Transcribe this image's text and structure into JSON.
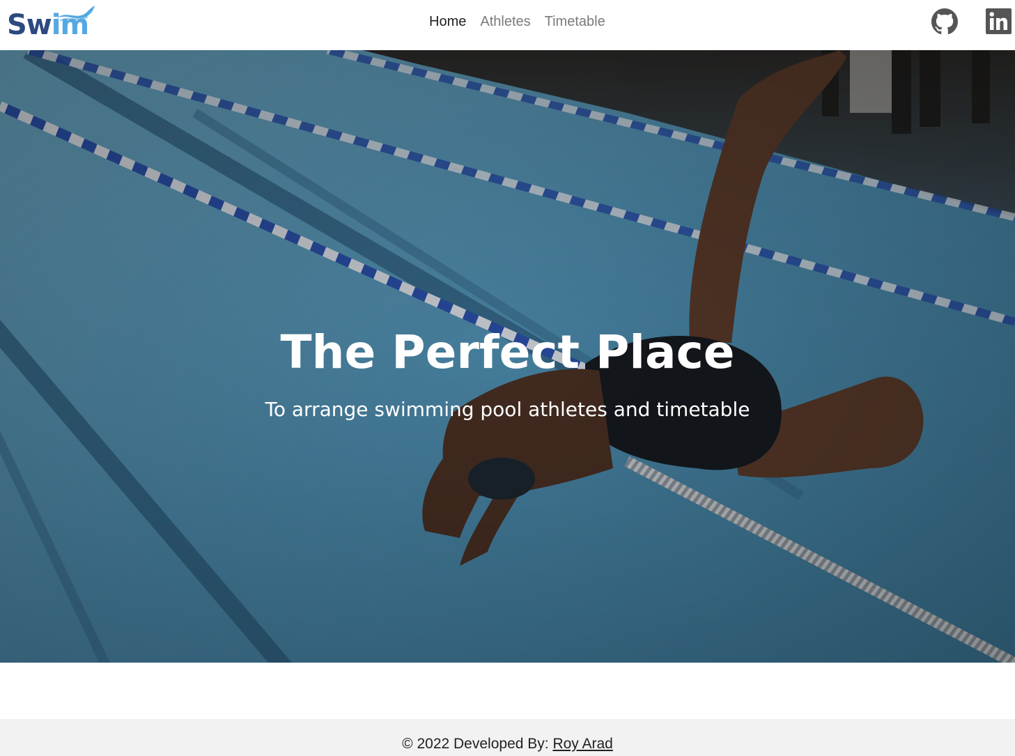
{
  "navbar": {
    "brand": {
      "text_a": "Sw",
      "text_b": "im",
      "colors": {
        "dark": "#2d4a80",
        "light": "#55a8e2"
      }
    },
    "links": [
      {
        "label": "Home",
        "active": true
      },
      {
        "label": "Athletes",
        "active": false
      },
      {
        "label": "Timetable",
        "active": false
      }
    ],
    "social": {
      "github_icon": "github-icon",
      "linkedin_icon": "linkedin-icon"
    }
  },
  "hero": {
    "title": "The Perfect Place",
    "subtitle": "To arrange swimming pool athletes and timetable"
  },
  "footer": {
    "prefix": "© 2022 Developed By: ",
    "author": "Roy Arad"
  },
  "colors": {
    "text_dark": "#222222",
    "nav_muted": "#7a7a7a",
    "footer_bg": "#f2f2f2",
    "pool_water": "#3f7fa0"
  }
}
